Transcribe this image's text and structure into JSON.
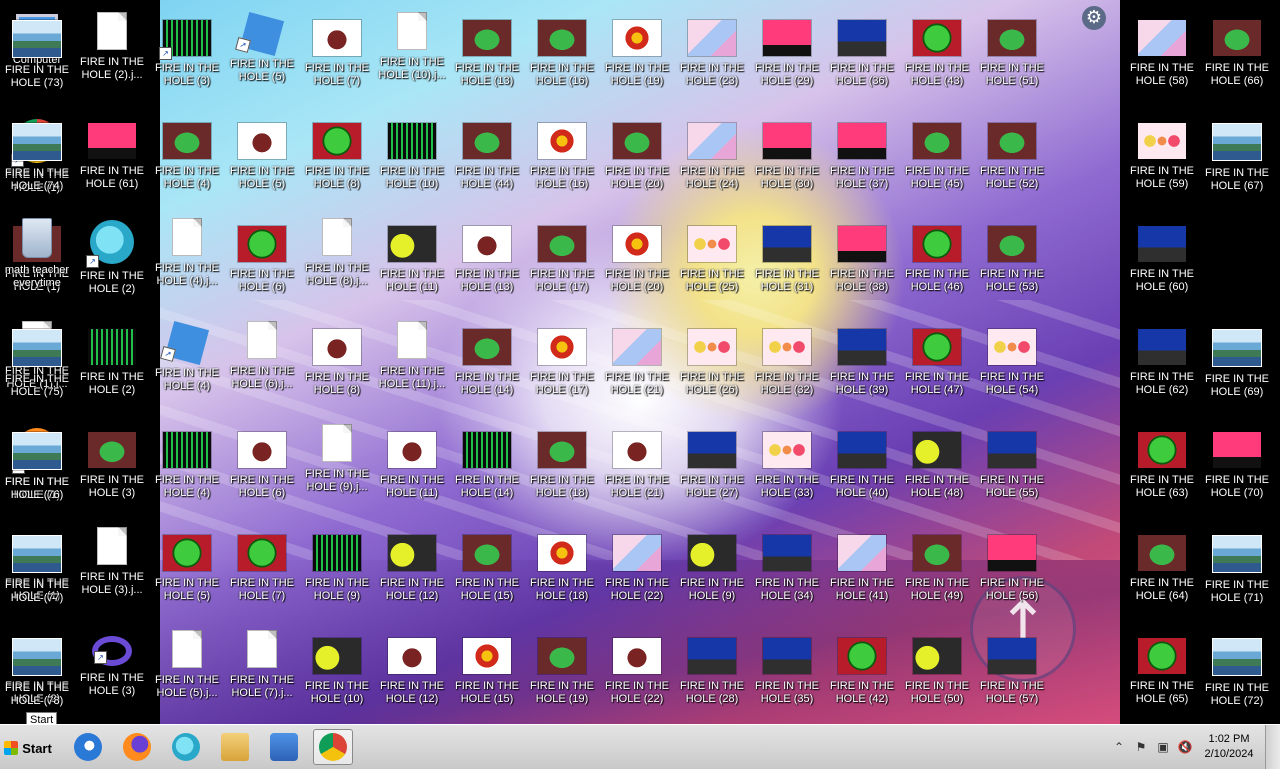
{
  "desktop": {
    "icons": [
      {
        "label": "Computer",
        "thumb": "computer",
        "shortcut": false
      },
      {
        "label": "FIRE IN THE HOLE (1)",
        "thumb": "chrome",
        "shortcut": true
      },
      {
        "label": "FIRE IN THE HOLE (1)",
        "thumb": "frog",
        "shortcut": false
      },
      {
        "label": "FIRE IN THE HOLE (1).j...",
        "thumb": "doc",
        "shortcut": false
      },
      {
        "label": "FIRE IN THE HOLE (1)",
        "thumb": "firefox",
        "shortcut": true
      },
      {
        "label": "FIRE IN THE HOLE (1)",
        "thumb": "matrix",
        "shortcut": false
      },
      {
        "label": "FIRE IN THE HOLE (2)",
        "thumb": "frog",
        "shortcut": false
      },
      {
        "label": "FIRE IN THE HOLE (2).j...",
        "thumb": "doc",
        "shortcut": false
      },
      {
        "label": "FIRE IN THE HOLE (61)",
        "thumb": "pink",
        "shortcut": false
      },
      {
        "label": "FIRE IN THE HOLE (2)",
        "thumb": "edge",
        "shortcut": true
      },
      {
        "label": "FIRE IN THE HOLE (2)",
        "thumb": "matrix",
        "shortcut": false
      },
      {
        "label": "FIRE IN THE HOLE (3)",
        "thumb": "frog",
        "shortcut": false
      },
      {
        "label": "FIRE IN THE HOLE (3).j...",
        "thumb": "doc",
        "shortcut": false
      },
      {
        "label": "FIRE IN THE HOLE (3)",
        "thumb": "vs",
        "shortcut": true
      },
      {
        "label": "FIRE IN THE HOLE (3)",
        "thumb": "matrix",
        "shortcut": true
      },
      {
        "label": "FIRE IN THE HOLE (4)",
        "thumb": "frog",
        "shortcut": false
      },
      {
        "label": "FIRE IN THE HOLE (4).j...",
        "thumb": "doc",
        "shortcut": false
      },
      {
        "label": "FIRE IN THE HOLE (4)",
        "thumb": "roblox",
        "shortcut": true
      },
      {
        "label": "FIRE IN THE HOLE (4)",
        "thumb": "matrix",
        "shortcut": false
      },
      {
        "label": "FIRE IN THE HOLE (5)",
        "thumb": "green",
        "shortcut": false
      },
      {
        "label": "FIRE IN THE HOLE (5).j...",
        "thumb": "doc",
        "shortcut": false
      },
      {
        "label": "FIRE IN THE HOLE (5)",
        "thumb": "roblox",
        "shortcut": true
      },
      {
        "label": "FIRE IN THE HOLE (5)",
        "thumb": "heart",
        "shortcut": false
      },
      {
        "label": "FIRE IN THE HOLE (6)",
        "thumb": "green",
        "shortcut": false
      },
      {
        "label": "FIRE IN THE HOLE (6).j...",
        "thumb": "doc",
        "shortcut": false
      },
      {
        "label": "FIRE IN THE HOLE (6)",
        "thumb": "heart",
        "shortcut": false
      },
      {
        "label": "FIRE IN THE HOLE (7)",
        "thumb": "green",
        "shortcut": false
      },
      {
        "label": "FIRE IN THE HOLE (7).j...",
        "thumb": "doc",
        "shortcut": false
      },
      {
        "label": "FIRE IN THE HOLE (7)",
        "thumb": "heart",
        "shortcut": false
      },
      {
        "label": "FIRE IN THE HOLE (8)",
        "thumb": "green",
        "shortcut": false
      },
      {
        "label": "FIRE IN THE HOLE (8).j...",
        "thumb": "doc",
        "shortcut": false
      },
      {
        "label": "FIRE IN THE HOLE (8)",
        "thumb": "heart",
        "shortcut": false
      },
      {
        "label": "FIRE IN THE HOLE (9).j...",
        "thumb": "doc",
        "shortcut": false
      },
      {
        "label": "FIRE IN THE HOLE (9)",
        "thumb": "matrix",
        "shortcut": false
      },
      {
        "label": "FIRE IN THE HOLE (10)",
        "thumb": "yellow",
        "shortcut": false
      },
      {
        "label": "FIRE IN THE HOLE (10).j...",
        "thumb": "doc",
        "shortcut": false
      },
      {
        "label": "FIRE IN THE HOLE (10)",
        "thumb": "matrix",
        "shortcut": false
      },
      {
        "label": "FIRE IN THE HOLE (11)",
        "thumb": "yellow",
        "shortcut": false
      },
      {
        "label": "FIRE IN THE HOLE (11).j...",
        "thumb": "doc",
        "shortcut": false
      },
      {
        "label": "FIRE IN THE HOLE (11)",
        "thumb": "heart",
        "shortcut": false
      },
      {
        "label": "FIRE IN THE HOLE (12)",
        "thumb": "yellow",
        "shortcut": false
      },
      {
        "label": "FIRE IN THE HOLE (12)",
        "thumb": "heart",
        "shortcut": false
      },
      {
        "label": "FIRE IN THE HOLE (13)",
        "thumb": "frog",
        "shortcut": false
      },
      {
        "label": "FIRE IN THE HOLE (44)",
        "thumb": "frog",
        "shortcut": false
      },
      {
        "label": "FIRE IN THE HOLE (13)",
        "thumb": "heart",
        "shortcut": false
      },
      {
        "label": "FIRE IN THE HOLE (14)",
        "thumb": "frog",
        "shortcut": false
      },
      {
        "label": "FIRE IN THE HOLE (14)",
        "thumb": "matrix",
        "shortcut": false
      },
      {
        "label": "FIRE IN THE HOLE (15)",
        "thumb": "frog",
        "shortcut": false
      },
      {
        "label": "FIRE IN THE HOLE (15)",
        "thumb": "flower",
        "shortcut": false
      },
      {
        "label": "FIRE IN THE HOLE (16)",
        "thumb": "frog",
        "shortcut": false
      },
      {
        "label": "FIRE IN THE HOLE (16)",
        "thumb": "flower",
        "shortcut": false
      },
      {
        "label": "FIRE IN THE HOLE (17)",
        "thumb": "frog",
        "shortcut": false
      },
      {
        "label": "FIRE IN THE HOLE (17)",
        "thumb": "flower",
        "shortcut": false
      },
      {
        "label": "FIRE IN THE HOLE (18)",
        "thumb": "frog",
        "shortcut": false
      },
      {
        "label": "FIRE IN THE HOLE (18)",
        "thumb": "flower",
        "shortcut": false
      },
      {
        "label": "FIRE IN THE HOLE (19)",
        "thumb": "frog",
        "shortcut": false
      },
      {
        "label": "FIRE IN THE HOLE (19)",
        "thumb": "flower",
        "shortcut": false
      },
      {
        "label": "FIRE IN THE HOLE (20)",
        "thumb": "frog",
        "shortcut": false
      },
      {
        "label": "FIRE IN THE HOLE (20)",
        "thumb": "flower",
        "shortcut": false
      },
      {
        "label": "FIRE IN THE HOLE (21)",
        "thumb": "anime",
        "shortcut": false
      },
      {
        "label": "FIRE IN THE HOLE (21)",
        "thumb": "heart",
        "shortcut": false
      },
      {
        "label": "FIRE IN THE HOLE (22)",
        "thumb": "anime",
        "shortcut": false
      },
      {
        "label": "FIRE IN THE HOLE (22)",
        "thumb": "heart",
        "shortcut": false
      },
      {
        "label": "FIRE IN THE HOLE (23)",
        "thumb": "anime",
        "shortcut": false
      },
      {
        "label": "FIRE IN THE HOLE (24)",
        "thumb": "anime",
        "shortcut": false
      },
      {
        "label": "FIRE IN THE HOLE (25)",
        "thumb": "balls",
        "shortcut": false
      },
      {
        "label": "FIRE IN THE HOLE (26)",
        "thumb": "balls",
        "shortcut": false
      },
      {
        "label": "FIRE IN THE HOLE (27)",
        "thumb": "blue",
        "shortcut": false
      },
      {
        "label": "FIRE IN THE HOLE (9)",
        "thumb": "yellow",
        "shortcut": false
      },
      {
        "label": "FIRE IN THE HOLE (28)",
        "thumb": "blue",
        "shortcut": false
      },
      {
        "label": "FIRE IN THE HOLE (29)",
        "thumb": "pink",
        "shortcut": false
      },
      {
        "label": "FIRE IN THE HOLE (30)",
        "thumb": "pink",
        "shortcut": false
      },
      {
        "label": "FIRE IN THE HOLE (31)",
        "thumb": "blue",
        "shortcut": false
      },
      {
        "label": "FIRE IN THE HOLE (32)",
        "thumb": "balls",
        "shortcut": false
      },
      {
        "label": "FIRE IN THE HOLE (33)",
        "thumb": "balls",
        "shortcut": false
      },
      {
        "label": "FIRE IN THE HOLE (34)",
        "thumb": "blue",
        "shortcut": false
      },
      {
        "label": "FIRE IN THE HOLE (35)",
        "thumb": "blue",
        "shortcut": false
      },
      {
        "label": "FIRE IN THE HOLE (36)",
        "thumb": "blue",
        "shortcut": false
      },
      {
        "label": "FIRE IN THE HOLE (37)",
        "thumb": "pink",
        "shortcut": false
      },
      {
        "label": "FIRE IN THE HOLE (38)",
        "thumb": "pink",
        "shortcut": false
      },
      {
        "label": "FIRE IN THE HOLE (39)",
        "thumb": "blue",
        "shortcut": false
      },
      {
        "label": "FIRE IN THE HOLE (40)",
        "thumb": "blue",
        "shortcut": false
      },
      {
        "label": "FIRE IN THE HOLE (41)",
        "thumb": "anime",
        "shortcut": false
      },
      {
        "label": "FIRE IN THE HOLE (42)",
        "thumb": "green",
        "shortcut": false
      },
      {
        "label": "FIRE IN THE HOLE (43)",
        "thumb": "green",
        "shortcut": false
      },
      {
        "label": "FIRE IN THE HOLE (45)",
        "thumb": "frog",
        "shortcut": false
      },
      {
        "label": "FIRE IN THE HOLE (46)",
        "thumb": "green",
        "shortcut": false
      },
      {
        "label": "FIRE IN THE HOLE (47)",
        "thumb": "green",
        "shortcut": false
      },
      {
        "label": "FIRE IN THE HOLE (48)",
        "thumb": "yellow",
        "shortcut": false
      },
      {
        "label": "FIRE IN THE HOLE (49)",
        "thumb": "frog",
        "shortcut": false
      },
      {
        "label": "FIRE IN THE HOLE (50)",
        "thumb": "yellow",
        "shortcut": false
      },
      {
        "label": "FIRE IN THE HOLE (51)",
        "thumb": "frog",
        "shortcut": false
      },
      {
        "label": "FIRE IN THE HOLE (52)",
        "thumb": "frog",
        "shortcut": false
      },
      {
        "label": "FIRE IN THE HOLE (53)",
        "thumb": "frog",
        "shortcut": false
      },
      {
        "label": "FIRE IN THE HOLE (54)",
        "thumb": "balls",
        "shortcut": false
      },
      {
        "label": "FIRE IN THE HOLE (55)",
        "thumb": "blue",
        "shortcut": false
      },
      {
        "label": "FIRE IN THE HOLE (56)",
        "thumb": "pink",
        "shortcut": false
      },
      {
        "label": "FIRE IN THE HOLE (57)",
        "thumb": "blue",
        "shortcut": false
      },
      {
        "label": "FIRE IN THE HOLE (58)",
        "thumb": "anime",
        "shortcut": false
      },
      {
        "label": "FIRE IN THE HOLE (59)",
        "thumb": "balls",
        "shortcut": false
      },
      {
        "label": "FIRE IN THE HOLE (60)",
        "thumb": "blue",
        "shortcut": false
      },
      {
        "label": "FIRE IN THE HOLE (62)",
        "thumb": "blue",
        "shortcut": false
      },
      {
        "label": "FIRE IN THE HOLE (63)",
        "thumb": "green",
        "shortcut": false
      },
      {
        "label": "FIRE IN THE HOLE (64)",
        "thumb": "frog",
        "shortcut": false
      },
      {
        "label": "FIRE IN THE HOLE (65)",
        "thumb": "green",
        "shortcut": false
      },
      {
        "label": "FIRE IN THE HOLE (66)",
        "thumb": "frog",
        "shortcut": false
      },
      {
        "label": "FIRE IN THE HOLE (67)",
        "thumb": "ocean",
        "shortcut": false
      },
      {
        "label": "",
        "thumb": "none",
        "shortcut": false
      },
      {
        "label": "FIRE IN THE HOLE (69)",
        "thumb": "ocean",
        "shortcut": false
      },
      {
        "label": "FIRE IN THE HOLE (70)",
        "thumb": "pink",
        "shortcut": false
      },
      {
        "label": "FIRE IN THE HOLE (71)",
        "thumb": "ocean",
        "shortcut": false
      },
      {
        "label": "FIRE IN THE HOLE (72)",
        "thumb": "ocean",
        "shortcut": false
      },
      {
        "label": "FIRE IN THE HOLE (73)",
        "thumb": "ocean",
        "shortcut": false
      },
      {
        "label": "FIRE IN THE HOLE (74)",
        "thumb": "ocean",
        "shortcut": false
      },
      {
        "label": "math teacher everytime",
        "thumb": "bin",
        "shortcut": false
      },
      {
        "label": "FIRE IN THE HOLE (75)",
        "thumb": "ocean",
        "shortcut": false
      },
      {
        "label": "FIRE IN THE HOLE (76)",
        "thumb": "ocean",
        "shortcut": false
      },
      {
        "label": "FIRE IN THE HOLE (77)",
        "thumb": "ocean",
        "shortcut": false
      },
      {
        "label": "FIRE IN THE HOLE (78)",
        "thumb": "ocean",
        "shortcut": false
      }
    ]
  },
  "taskbar": {
    "start_label": "Start",
    "tooltip": "Start",
    "pinned": [
      {
        "name": "internet-explorer-icon",
        "style": "ie",
        "active": false
      },
      {
        "name": "firefox-icon",
        "style": "ff",
        "active": false
      },
      {
        "name": "edge-icon",
        "style": "edge",
        "active": false
      },
      {
        "name": "file-explorer-icon",
        "style": "fold",
        "active": false
      },
      {
        "name": "media-player-icon",
        "style": "media",
        "active": false
      },
      {
        "name": "chrome-icon",
        "style": "chr",
        "active": true
      }
    ],
    "tray": {
      "up_arrow": "⌃",
      "flag": "⚑",
      "network": "▣",
      "volume": "🔇",
      "time": "1:02 PM",
      "date": "2/10/2024"
    }
  }
}
